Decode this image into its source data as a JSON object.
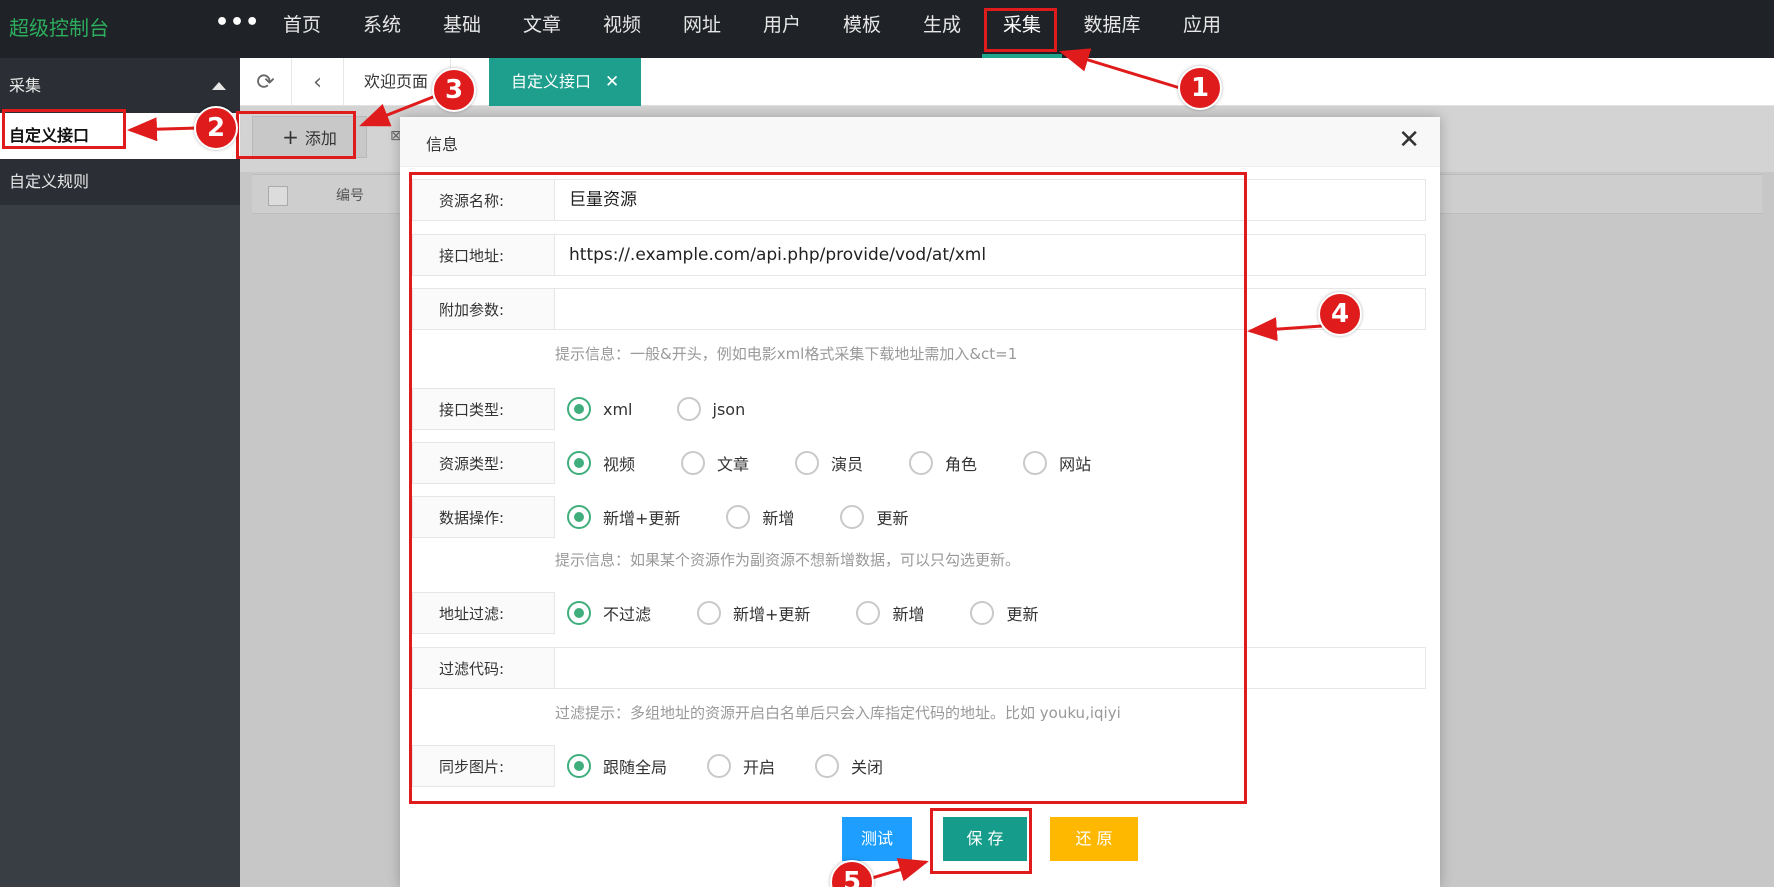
{
  "brand": "超级控制台",
  "more_label": "•••",
  "nav": [
    {
      "label": "首页",
      "name": "nav-home"
    },
    {
      "label": "系统",
      "name": "nav-system"
    },
    {
      "label": "基础",
      "name": "nav-basic"
    },
    {
      "label": "文章",
      "name": "nav-article"
    },
    {
      "label": "视频",
      "name": "nav-video"
    },
    {
      "label": "网址",
      "name": "nav-url"
    },
    {
      "label": "用户",
      "name": "nav-user"
    },
    {
      "label": "模板",
      "name": "nav-template"
    },
    {
      "label": "生成",
      "name": "nav-generate"
    },
    {
      "label": "采集",
      "name": "nav-collect",
      "active": true
    },
    {
      "label": "数据库",
      "name": "nav-database"
    },
    {
      "label": "应用",
      "name": "nav-app"
    }
  ],
  "sidebar": {
    "group": "采集",
    "items": [
      "自定义接口",
      "自定义规则"
    ]
  },
  "tabs": {
    "home": "欢迎页面",
    "current": "自定义接口",
    "close": "✕"
  },
  "toolbar": {
    "add": "添加",
    "add_icon": "+"
  },
  "table": {
    "col_id": "编号"
  },
  "modal": {
    "title": "信息",
    "close": "✕",
    "name_label": "资源名称:",
    "name_value": "巨量资源",
    "api_label": "接口地址:",
    "api_value": "https://.example.com/api.php/provide/vod/at/xml",
    "param_label": "附加参数:",
    "param_value": "",
    "param_tip": "提示信息：一般&开头，例如电影xml格式采集下载地址需加入&ct=1",
    "api_type_label": "接口类型:",
    "api_type_options": [
      "xml",
      "json"
    ],
    "res_type_label": "资源类型:",
    "res_type_options": [
      "视频",
      "文章",
      "演员",
      "角色",
      "网站"
    ],
    "data_op_label": "数据操作:",
    "data_op_options": [
      "新增+更新",
      "新增",
      "更新"
    ],
    "data_op_tip": "提示信息：如果某个资源作为副资源不想新增数据，可以只勾选更新。",
    "url_filter_label": "地址过滤:",
    "url_filter_options": [
      "不过滤",
      "新增+更新",
      "新增",
      "更新"
    ],
    "filter_code_label": "过滤代码:",
    "filter_code_value": "",
    "filter_tip": "过滤提示：多组地址的资源开启白名单后只会入库指定代码的地址。比如 youku,iqiyi",
    "sync_img_label": "同步图片:",
    "sync_img_options": [
      "跟随全局",
      "开启",
      "关闭"
    ],
    "btn_test": "测试",
    "btn_save": "保 存",
    "btn_reset": "还 原"
  },
  "annotations": [
    "1",
    "2",
    "3",
    "4",
    "5"
  ],
  "colors": {
    "accent": "#1e9f8d",
    "brand_green": "#2cae5e",
    "annotation_red": "#e01b1b",
    "test_blue": "#1e9fff",
    "reset_yellow": "#ffb800"
  }
}
